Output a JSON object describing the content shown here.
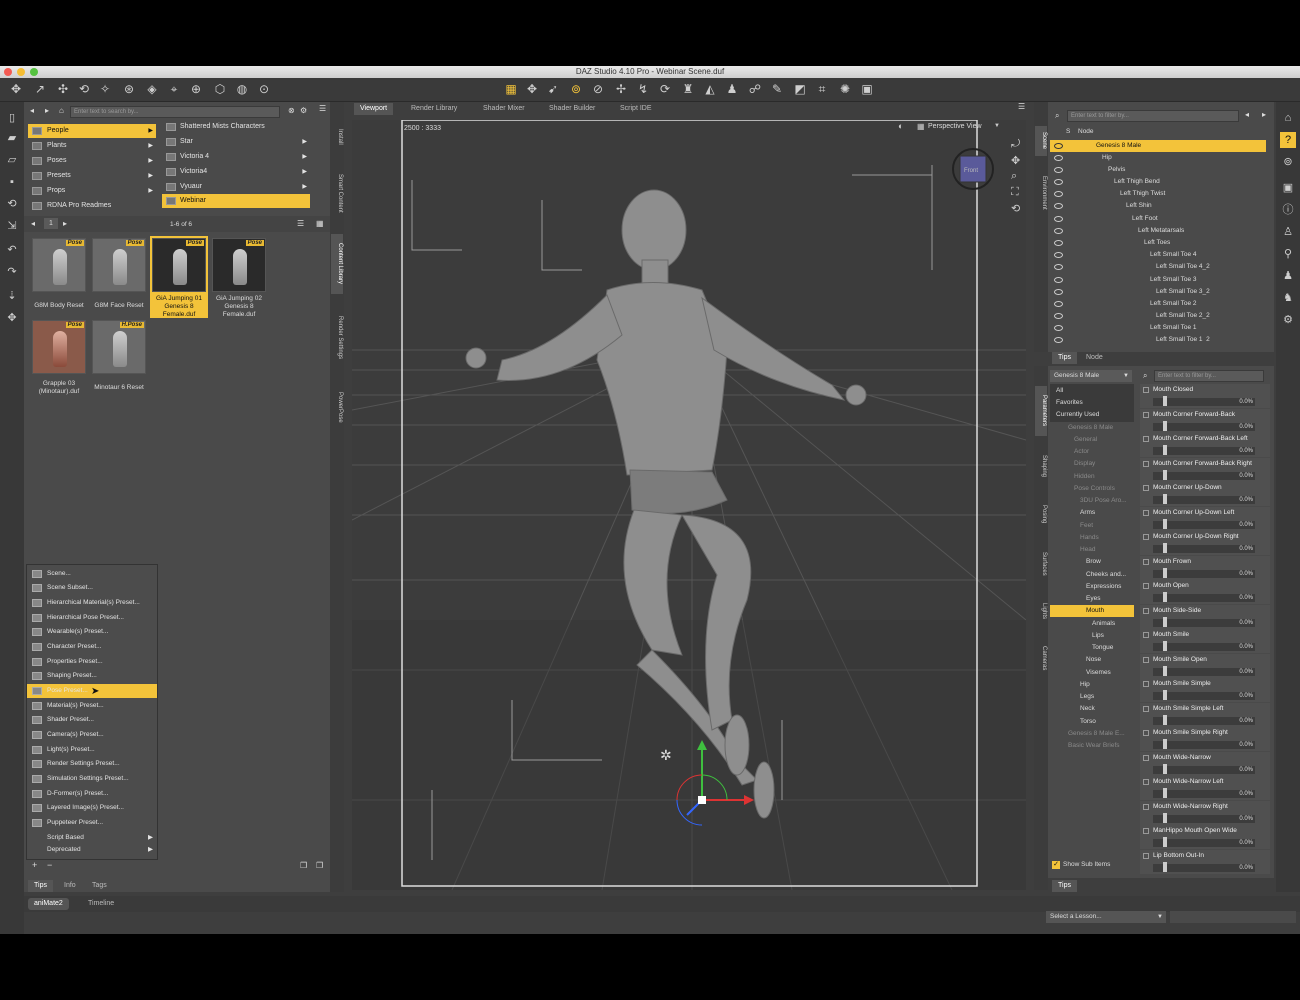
{
  "window": {
    "title": "DAZ Studio 4.10 Pro - Webinar Scene.duf"
  },
  "colors": {
    "accent": "#f3c33a",
    "background": "#3e3e3e",
    "panel": "#4a4a4a"
  },
  "content": {
    "search_placeholder": "Enter text to search by...",
    "categories": [
      {
        "label": "People",
        "selected": true
      },
      {
        "label": "Plants"
      },
      {
        "label": "Poses"
      },
      {
        "label": "Presets"
      },
      {
        "label": "Props"
      },
      {
        "label": "RDNA Pro Readmes"
      }
    ],
    "subcategories": [
      {
        "label": "Shattered Mists Characters"
      },
      {
        "label": "Star"
      },
      {
        "label": "Victoria 4"
      },
      {
        "label": "Victoria4"
      },
      {
        "label": "Vyuaur"
      },
      {
        "label": "Webinar",
        "selected": true
      }
    ],
    "pager": {
      "page": "1",
      "range": "1-6 of 6"
    },
    "assets": [
      {
        "label": "G8M Body Reset",
        "badge": "Pose"
      },
      {
        "label": "G8M Face Reset",
        "badge": "Pose"
      },
      {
        "label": "GiA Jumping 01 Genesis 8 Female.duf",
        "badge": "Pose"
      },
      {
        "label": "GiA Jumping 02 Genesis 8 Female.duf",
        "badge": "Pose"
      },
      {
        "label": "Grapple 03 (Minotaur).duf",
        "badge": "Pose"
      },
      {
        "label": "Minotaur 6 Reset",
        "badge": "H.Pose"
      }
    ],
    "side_tabs": [
      "Install",
      "Smart Content",
      "Content Library",
      "Render Settings",
      "PowerPose"
    ],
    "bottom_tabs": [
      "Tips",
      "Info",
      "Tags"
    ]
  },
  "save_menu": [
    "Scene...",
    "Scene Subset...",
    "Hierarchical Material(s) Preset...",
    "Hierarchical Pose Preset...",
    "Wearable(s) Preset...",
    "Character Preset...",
    "Properties Preset...",
    "Shaping Preset...",
    "Pose Preset...",
    "Material(s) Preset...",
    "Shader Preset...",
    "Camera(s) Preset...",
    "Light(s) Preset...",
    "Render Settings Preset...",
    "Simulation Settings Preset...",
    "D-Former(s) Preset...",
    "Layered Image(s) Preset...",
    "Puppeteer Preset..."
  ],
  "save_menu_selected": "Pose Preset...",
  "save_menu_submenus": [
    "Script Based",
    "Deprecated"
  ],
  "viewport": {
    "tabs": [
      "Viewport",
      "Render Library",
      "Shader Mixer",
      "Shader Builder",
      "Script IDE"
    ],
    "resolution": "2500 : 3333",
    "camera": "Perspective View",
    "cube": "Front"
  },
  "scene": {
    "filter_placeholder": "Enter text to filter by...",
    "col_s": "S",
    "col_node": "Node",
    "nodes": [
      "Genesis 8 Male",
      "Hip",
      "Pelvis",
      "Left Thigh Bend",
      "Left Thigh Twist",
      "Left Shin",
      "Left Foot",
      "Left Metatarsals",
      "Left Toes",
      "Left Small Toe 4",
      "Left Small Toe 4_2",
      "Left Small Toe 3",
      "Left Small Toe 3_2",
      "Left Small Toe 2",
      "Left Small Toe 2_2",
      "Left Small Toe 1",
      "Left Small Toe 1_2"
    ],
    "tabs": [
      "Tips",
      "Node"
    ],
    "side_tabs": [
      "Scene",
      "Environment"
    ]
  },
  "parameters": {
    "node_select": "Genesis 8 Male",
    "filter_placeholder": "Enter text to filter by...",
    "tree": [
      "All",
      "Favorites",
      "Currently Used",
      "Genesis 8 Male",
      "General",
      "Actor",
      "Display",
      "Hidden",
      "Pose Controls",
      "3DU Pose Aro...",
      "Arms",
      "Feet",
      "Hands",
      "Head",
      "Brow",
      "Cheeks and...",
      "Expressions",
      "Eyes",
      "Mouth",
      "Animals",
      "Lips",
      "Tongue",
      "Nose",
      "Visemes",
      "Hip",
      "Legs",
      "Neck",
      "Torso",
      "Genesis 8 Male E...",
      "Basic Wear Briefs"
    ],
    "selected": "Mouth",
    "show_sub": "Show Sub Items",
    "sliders": [
      "Mouth Closed",
      "Mouth Corner Forward-Back",
      "Mouth Corner Forward-Back  Left",
      "Mouth Corner Forward-Back Right",
      "Mouth Corner Up-Down",
      "Mouth Corner Up-Down Left",
      "Mouth Corner Up-Down Right",
      "Mouth Frown",
      "Mouth Open",
      "Mouth Side-Side",
      "Mouth Smile",
      "Mouth Smile Open",
      "Mouth Smile Simple",
      "Mouth Smile Simple Left",
      "Mouth Smile Simple Right",
      "Mouth Wide-Narrow",
      "Mouth Wide-Narrow Left",
      "Mouth Wide-Narrow Right",
      "ManHippo Mouth Open Wide",
      "Lip Bottom Out-In"
    ],
    "slider_value": "0.0%",
    "side_tabs": [
      "Parameters",
      "Shaping",
      "Posing",
      "Surfaces",
      "Lights",
      "Cameras"
    ],
    "bottom_tab": "Tips"
  },
  "bottom": {
    "tabs": [
      "aniMate2",
      "Timeline"
    ],
    "lesson_placeholder": "Select a Lesson..."
  }
}
